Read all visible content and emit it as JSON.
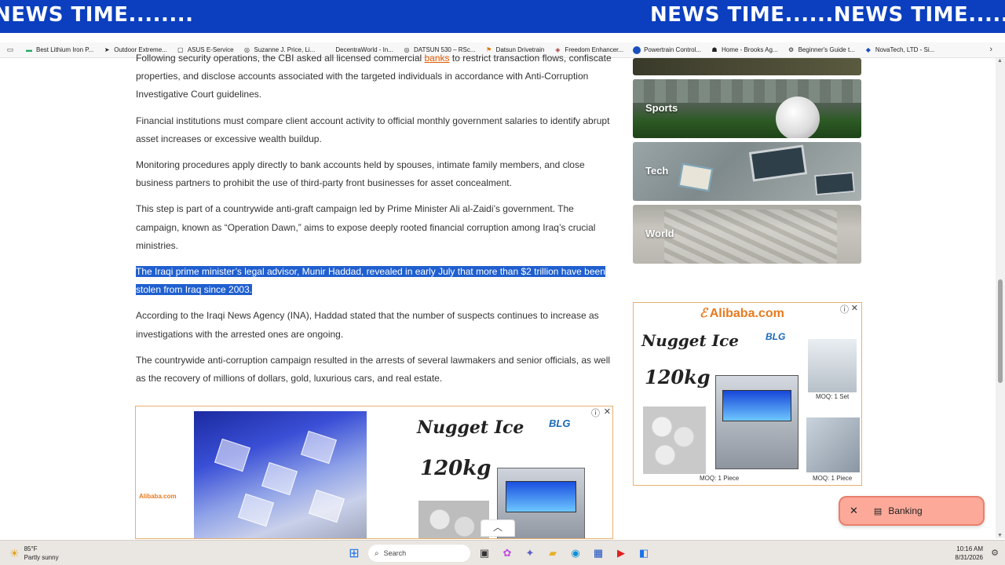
{
  "ticker": {
    "text_left": "NEWS TIME........",
    "text_right": "NEWS TIME......NEWS TIME........"
  },
  "bookmarks": [
    {
      "label": "Best Lithium Iron P...",
      "icon": "battery-icon"
    },
    {
      "label": "Outdoor Extreme...",
      "icon": "compass-icon"
    },
    {
      "label": "ASUS E-Service",
      "icon": "folder-icon"
    },
    {
      "label": "Suzanne J. Price, Li...",
      "icon": "globe-icon"
    },
    {
      "label": "DecentraWorld - In...",
      "icon": "site-icon"
    },
    {
      "label": "DATSUN 530 – RSc...",
      "icon": "globe-icon"
    },
    {
      "label": "Datsun Drivetrain",
      "icon": "flag-icon"
    },
    {
      "label": "Freedom Enhancer...",
      "icon": "shield-icon"
    },
    {
      "label": "Powertrain Control...",
      "icon": "site-icon"
    },
    {
      "label": "Home - Brooks Ag...",
      "icon": "user-icon"
    },
    {
      "label": "Beginner's Guide t...",
      "icon": "gear-icon"
    },
    {
      "label": "NovaTech, LTD - Si...",
      "icon": "site-icon"
    }
  ],
  "article": {
    "p1_pre": "Following security operations, the CBI asked all licensed commercial ",
    "p1_link": "banks",
    "p1_post": " to restrict transaction flows, confiscate properties, and disclose accounts associated with the targeted individuals in accordance with Anti-Corruption Investigative Court guidelines.",
    "p2": "Financial institutions must compare client account activity to official monthly government salaries to identify abrupt asset increases or excessive wealth buildup.",
    "p3": "Monitoring procedures apply directly to bank accounts held by spouses, intimate family members, and close business partners to prohibit the use of third-party front businesses for asset concealment.",
    "p4": "This step is part of a countrywide anti-graft campaign led by Prime Minister Ali al-Zaidi’s government. The campaign, known as “Operation Dawn,” aims to expose deeply rooted financial corruption among Iraq’s crucial ministries.",
    "p5": "The Iraqi prime minister’s legal advisor, Munir Haddad, revealed in early July that more than $2 trillion have been stolen from Iraq since 2003.",
    "p6": "According to the Iraqi News Agency (INA), Haddad stated that the number of suspects continues to increase as investigations with the arrested ones are ongoing.",
    "p7": "The countrywide anti-corruption campaign resulted in the arrests of several lawmakers and senior officials, as well as the recovery of millions of dollars, gold, luxurious cars, and real estate."
  },
  "sidebar": {
    "categories": [
      "Sports",
      "Tech",
      "World"
    ]
  },
  "ad_right": {
    "brand": "Alibaba.com",
    "title": "Nugget Ice",
    "capacity": "120kg",
    "blg": "BLG",
    "moq_set": "MOQ: 1 Set",
    "moq_piece_1": "MOQ: 1 Piece",
    "moq_piece_2": "MOQ: 1 Piece"
  },
  "ad_bottom": {
    "title": "Nugget Ice",
    "capacity": "120kg",
    "blg": "BLG",
    "brand_small": "Alibaba.com"
  },
  "toast": {
    "label": "Banking"
  },
  "taskbar": {
    "weather_temp": "85°F",
    "weather_desc": "Partly sunny",
    "search_placeholder": "Search",
    "time": "10:16 AM",
    "date": "8/31/2026"
  }
}
